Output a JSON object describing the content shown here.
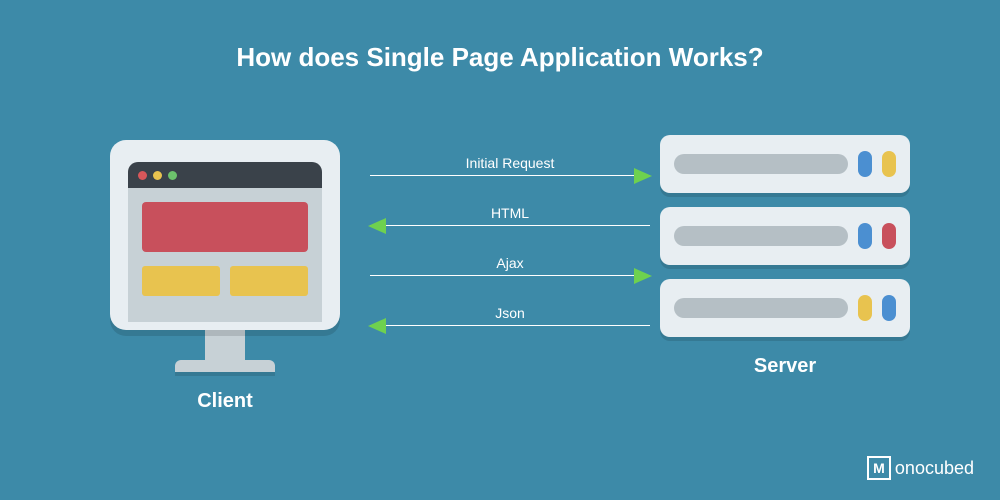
{
  "title": "How does Single Page Application Works?",
  "client": {
    "label": "Client"
  },
  "server": {
    "label": "Server"
  },
  "arrows": [
    {
      "label": "Initial Request",
      "direction": "right"
    },
    {
      "label": "HTML",
      "direction": "left"
    },
    {
      "label": "Ajax",
      "direction": "right"
    },
    {
      "label": "Json",
      "direction": "left"
    }
  ],
  "logo": {
    "mark": "M",
    "text": "onocubed"
  }
}
